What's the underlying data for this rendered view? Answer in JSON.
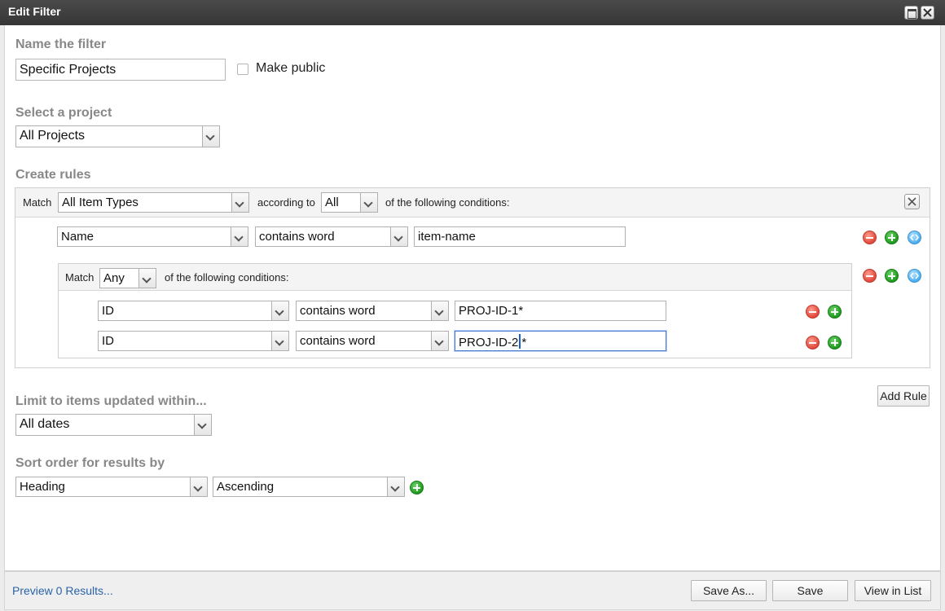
{
  "window": {
    "title": "Edit Filter"
  },
  "name_section": {
    "label": "Name the filter",
    "value": "Specific Projects",
    "make_public_label": "Make public",
    "make_public_checked": false
  },
  "project_section": {
    "label": "Select a project",
    "value": "All Projects"
  },
  "rules_section": {
    "label": "Create rules",
    "match_label": "Match",
    "item_type": "All Item Types",
    "according_to_label": "according to",
    "according_value": "All",
    "conditions_suffix": "of the following conditions:",
    "rule1": {
      "field": "Name",
      "operator": "contains word",
      "value": "item-name"
    },
    "group": {
      "match_label": "Match",
      "match_value": "Any",
      "conditions_suffix": "of the following conditions:",
      "rules": [
        {
          "field": "ID",
          "operator": "contains word",
          "value": "PROJ-ID-1*"
        },
        {
          "field": "ID",
          "operator": "contains word",
          "value_before": "PROJ-ID-2",
          "value_after": "*"
        }
      ]
    },
    "add_rule_label": "Add Rule"
  },
  "limit_section": {
    "label": "Limit to items updated within...",
    "value": "All dates"
  },
  "sort_section": {
    "label": "Sort order for results by",
    "field": "Heading",
    "direction": "Ascending"
  },
  "footer": {
    "preview_link": "Preview 0 Results...",
    "save_as_label": "Save As...",
    "save_label": "Save",
    "view_in_list_label": "View in List"
  },
  "colors": {
    "titlebar": "#3f3f3f",
    "link": "#2a63a8",
    "remove": "#e0483a",
    "add": "#1e9a1e",
    "nest": "#48aef0",
    "section_label": "#888888"
  },
  "icons": {
    "maximize": "maximize-icon",
    "close": "close-icon",
    "remove": "remove-circle-icon",
    "add": "add-circle-icon",
    "nest": "nest-condition-icon",
    "dropdown": "chevron-down-icon"
  }
}
